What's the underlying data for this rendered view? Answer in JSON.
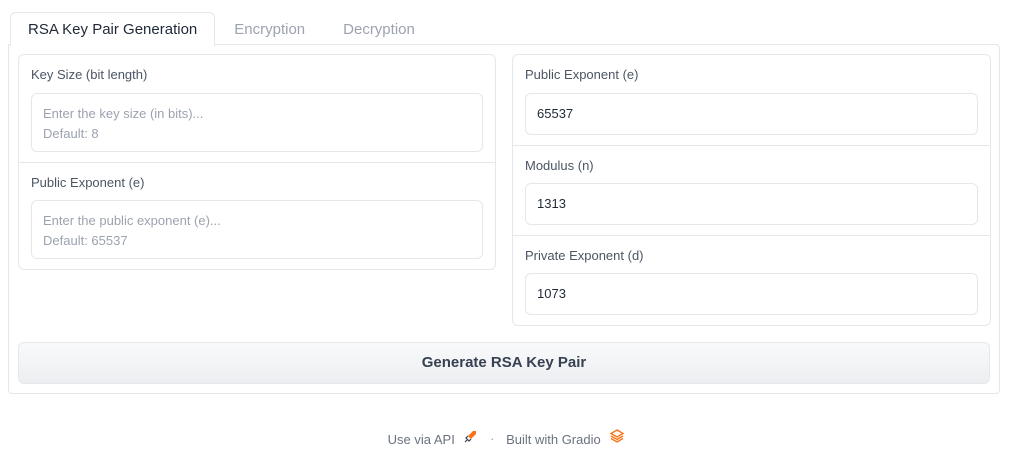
{
  "tabs": [
    {
      "label": "RSA Key Pair Generation",
      "active": true
    },
    {
      "label": "Encryption",
      "active": false
    },
    {
      "label": "Decryption",
      "active": false
    }
  ],
  "left": {
    "key_size": {
      "label": "Key Size (bit length)",
      "placeholder": "Enter the key size (in bits)...\nDefault: 8"
    },
    "public_exponent": {
      "label": "Public Exponent (e)",
      "placeholder": "Enter the public exponent (e)...\nDefault: 65537"
    }
  },
  "right": {
    "public_exponent": {
      "label": "Public Exponent (e)",
      "value": "65537"
    },
    "modulus": {
      "label": "Modulus (n)",
      "value": "1313"
    },
    "private_exponent": {
      "label": "Private Exponent (d)",
      "value": "1073"
    }
  },
  "generate_button": {
    "label": "Generate RSA Key Pair"
  },
  "footer": {
    "api_label": "Use via API",
    "separator": "·",
    "built_with": "Built with Gradio"
  },
  "colors": {
    "accent": "#f97316",
    "border": "#e5e7eb"
  },
  "icons": {
    "api": "rocket-icon",
    "gradio": "gradio-logo-icon"
  }
}
